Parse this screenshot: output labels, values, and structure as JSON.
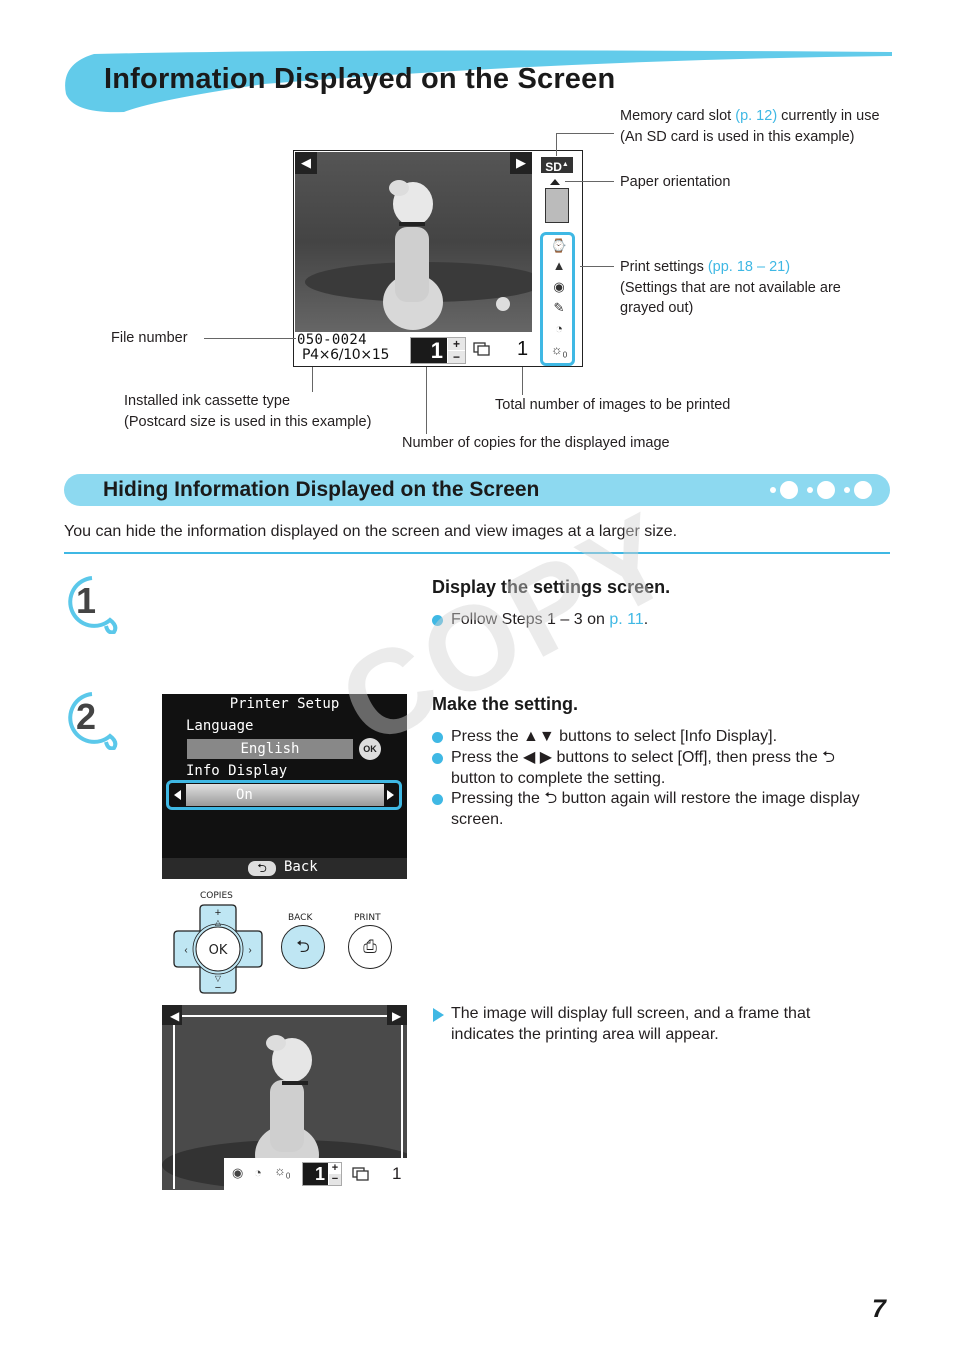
{
  "page": {
    "title": "Information Displayed on the Screen",
    "page_number": "7",
    "watermark": "COPY"
  },
  "lcd_main": {
    "prev_icon": "◀",
    "next_icon": "▶",
    "card_slot": "SD",
    "file_number": "050-0024",
    "ink_type": "P4×6/10×15",
    "copies": "1",
    "plus": "+",
    "minus": "−",
    "total": "1",
    "settings_icons": [
      "date-icon",
      "image-optimize-icon",
      "red-eye-icon",
      "my-colors-icon",
      "red-eye-correction-icon",
      "brightness-icon"
    ],
    "brightness_value": "0"
  },
  "callouts": {
    "memory_card": {
      "pre": "Memory card slot ",
      "link": "(p. 12)",
      "post": " currently in use (An SD card is used in this example)"
    },
    "paper_orientation": "Paper orientation",
    "print_settings": {
      "pre": "Print settings ",
      "link": "(pp. 18 – 21)",
      "post": "(Settings that are not available are grayed out)"
    },
    "file_number": "File number",
    "ink_cassette_line1": "Installed ink cassette type",
    "ink_cassette_line2": "(Postcard size is used in this example)",
    "total_images": "Total number of images to be printed",
    "copies": "Number of copies for the displayed image"
  },
  "section": {
    "title": "Hiding Information Displayed on the Screen",
    "intro": "You can hide the information displayed on the screen and view images at a larger size."
  },
  "steps": [
    {
      "number": "1",
      "title": "Display the settings screen.",
      "bullets": [
        {
          "pre": "Follow Steps 1 – 3 on ",
          "link": "p. 11",
          "post": "."
        }
      ]
    },
    {
      "number": "2",
      "title": "Make the setting.",
      "bullets": [
        "Press the ▲▼ buttons to select [Info Display].",
        "Press the ◀ ▶ buttons to select [Off], then press the ⮌ button to complete the setting.",
        "Pressing the ⮌ button again will restore the image display screen."
      ],
      "result": "The image will display full screen, and a frame that indicates the printing area will appear."
    }
  ],
  "setup_screen": {
    "title": "Printer Setup",
    "language_label": "Language",
    "language_value": "English",
    "ok_label": "OK",
    "info_label": "Info Display",
    "info_value": "On",
    "back_label": "Back"
  },
  "controls": {
    "copies_label": "COPIES",
    "ok_label": "OK",
    "back_label": "BACK",
    "print_label": "PRINT"
  },
  "full_screen": {
    "copies": "1",
    "total": "1",
    "brightness_value": "0"
  },
  "colors": {
    "accent": "#3fb8e4",
    "section_bar": "#8dd9f0",
    "text": "#231f20"
  }
}
